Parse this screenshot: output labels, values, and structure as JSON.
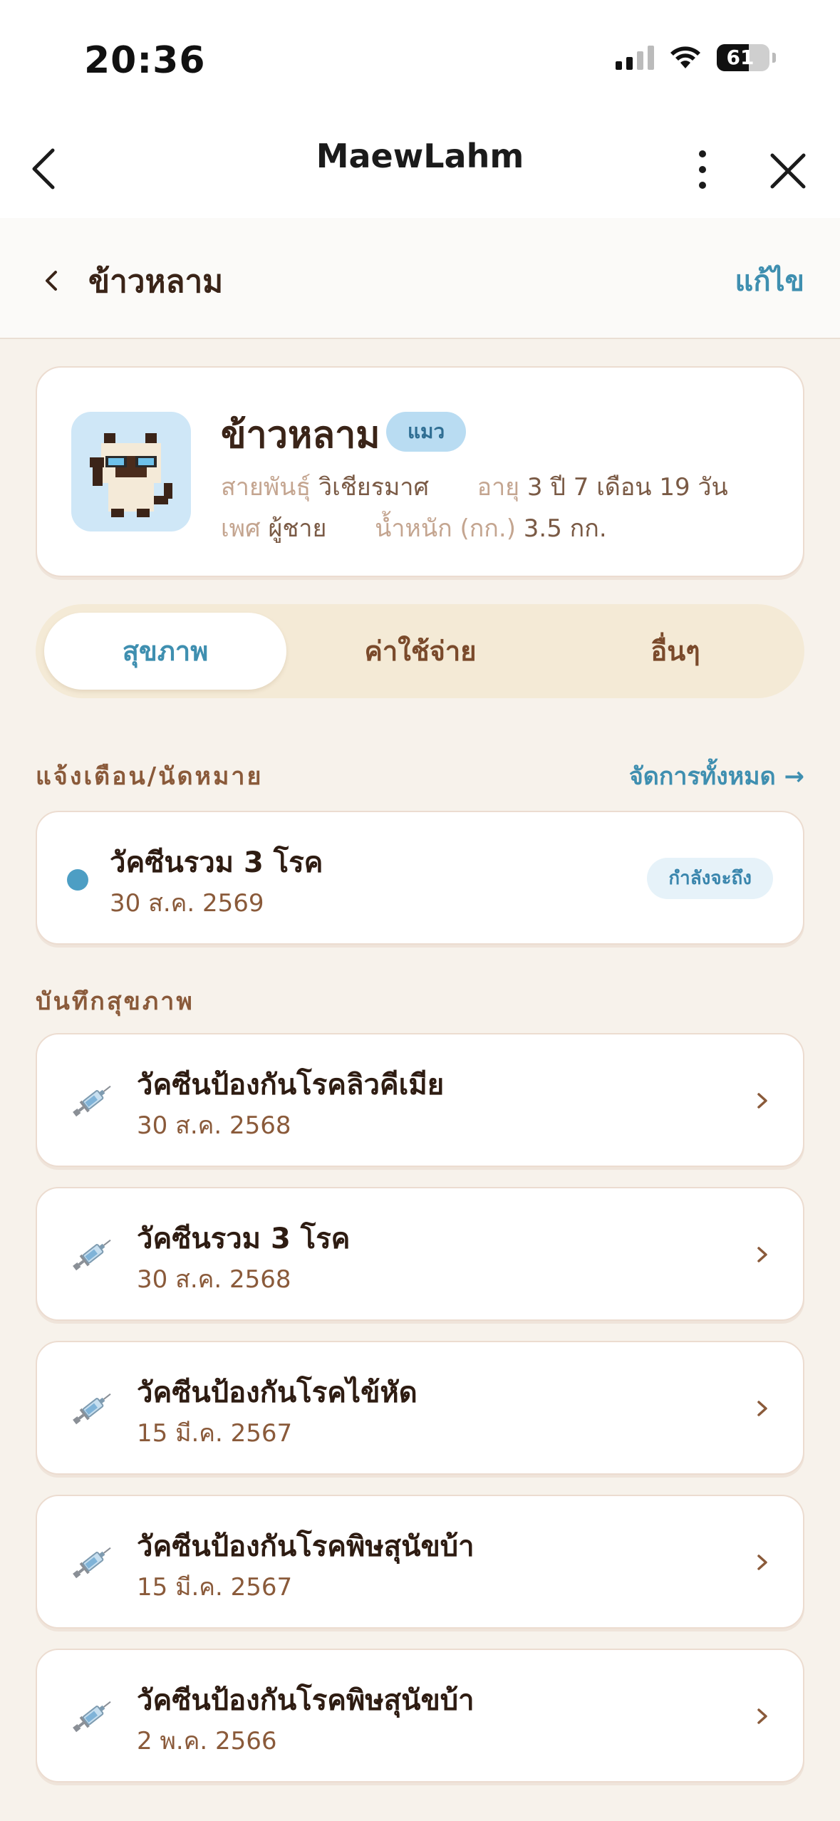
{
  "status": {
    "time": "20:36",
    "battery": "61",
    "battery_level": 0.61
  },
  "app": {
    "title": "MaewLahm"
  },
  "subheader": {
    "title": "ข้าวหลาม",
    "edit_label": "แก้ไข"
  },
  "profile": {
    "name": "ข้าวหลาม",
    "species": "แมว",
    "breed_label": "สายพันธุ์",
    "breed": "วิเชียรมาศ",
    "age_label": "อายุ",
    "age": "3 ปี 7 เดือน 19 วัน",
    "sex_label": "เพศ",
    "sex": "ผู้ชาย",
    "weight_label": "น้ำหนัก (กก.)",
    "weight": "3.5 กก."
  },
  "tabs": [
    {
      "label": "สุขภาพ",
      "active": true
    },
    {
      "label": "ค่าใช้จ่าย",
      "active": false
    },
    {
      "label": "อื่นๆ",
      "active": false
    }
  ],
  "reminders": {
    "title": "แจ้งเตือน/นัดหมาย",
    "manage_label": "จัดการทั้งหมด →",
    "items": [
      {
        "title": "วัคซีนรวม 3 โรค",
        "date": "30 ส.ค. 2569",
        "badge": "กำลังจะถึง"
      }
    ]
  },
  "records": {
    "title": "บันทึกสุขภาพ",
    "items": [
      {
        "title": "วัคซีนป้องกันโรคลิวคีเมีย",
        "date": "30 ส.ค. 2568",
        "icon": "syringe-icon"
      },
      {
        "title": "วัคซีนรวม 3 โรค",
        "date": "30 ส.ค. 2568",
        "icon": "syringe-icon"
      },
      {
        "title": "วัคซีนป้องกันโรคไข้หัด",
        "date": "15 มี.ค. 2567",
        "icon": "syringe-icon"
      },
      {
        "title": "วัคซีนป้องกันโรคพิษสุนัขบ้า",
        "date": "15 มี.ค. 2567",
        "icon": "syringe-icon"
      },
      {
        "title": "วัคซีนป้องกันโรคพิษสุนัขบ้า",
        "date": "2 พ.ค. 2566",
        "icon": "syringe-icon"
      }
    ]
  },
  "colors": {
    "accent": "#3f8fb0",
    "brown": "#8a5a3a",
    "background": "#f7f2eb",
    "badge_blue": "#b9dcf2"
  }
}
